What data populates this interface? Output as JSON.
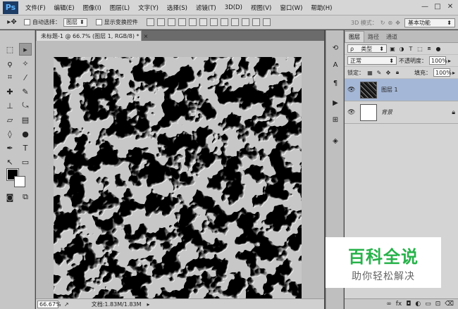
{
  "app": {
    "logo": "Ps"
  },
  "menu": [
    "文件(F)",
    "编辑(E)",
    "图像(I)",
    "图层(L)",
    "文字(Y)",
    "选择(S)",
    "滤镜(T)",
    "3D(D)",
    "视图(V)",
    "窗口(W)",
    "帮助(H)"
  ],
  "window_controls": {
    "minimize": "—",
    "restore": "□",
    "close": "✕"
  },
  "options": {
    "auto_select_label": "自动选择：",
    "auto_select_value": "图层",
    "show_transform_label": "显示变换控件",
    "mode_3d_label": "3D 模式：",
    "workspace": "基本功能"
  },
  "document": {
    "tab_title": "未标题-1 @ 66.7% (图层 1, RGB/8) *",
    "tab_close": "×",
    "zoom": "66.67%",
    "doc_info": "文档:1.83M/1.83M"
  },
  "layers_panel": {
    "tabs": [
      "图层",
      "路径",
      "通道"
    ],
    "filter_kind": "类型",
    "blend_mode": "正常",
    "opacity_label": "不透明度：",
    "opacity_value": "100%",
    "lock_label": "锁定：",
    "fill_label": "填充：",
    "fill_value": "100%",
    "layers": [
      {
        "name": "图层 1",
        "selected": true
      },
      {
        "name": "背景",
        "selected": false,
        "locked": true
      }
    ],
    "footer_icons": [
      "link-icon",
      "fx-icon",
      "mask-icon",
      "adjustment-icon",
      "folder-icon",
      "new-layer-icon",
      "trash-icon"
    ]
  },
  "watermark": {
    "title": "百科全说",
    "subtitle": "助你轻松解决"
  },
  "colors": {
    "selected_layer": "#a5b7d6",
    "watermark_green": "#27b24a",
    "canvas": "#000000"
  }
}
